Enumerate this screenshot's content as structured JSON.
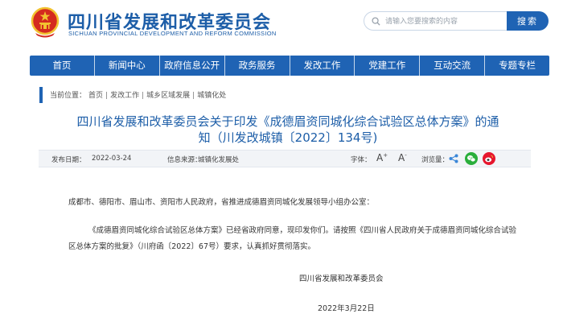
{
  "header": {
    "title": "四川省发展和改革委员会",
    "subtitle": "SICHUAN PROVINCIAL DEVELOPMENT AND REFORM COMMISSION",
    "search_placeholder": "请输入您要搜索的内容",
    "search_button": "搜索"
  },
  "nav": [
    "首页",
    "新闻中心",
    "政府信息公开",
    "政务服务",
    "发改工作",
    "党建工作",
    "互动交流",
    "专题专栏"
  ],
  "breadcrumb": {
    "label": "当前位置：",
    "items": [
      "首页",
      "发改工作",
      "城乡区域发展",
      "城镇化处"
    ]
  },
  "article": {
    "title_line1": "四川省发展和改革委员会关于印发《成德眉资同城化综合试验区总体方案》的通",
    "title_line2": "知（川发改城镇〔2022〕134号)",
    "publish_label": "发布日期：",
    "publish_date": "2022-03-24",
    "source_label": "信息来源：",
    "source": "城镇化发展处",
    "font_label": "字体：",
    "font_up": "A",
    "font_up_mark": "+",
    "font_down": "A",
    "font_down_mark": "-",
    "views_label": "浏览量：",
    "addressee": "成都市、德阳市、眉山市、资阳市人民政府，省推进成德眉资同城化发展领导小组办公室：",
    "body_line1": "《成德眉资同城化综合试验区总体方案》已经省政府同意，现印发你们。请按照《四川省人民政府关于成德眉资同城化综合试验",
    "body_line2": "区总体方案的批复》（川府函〔2022〕67号）要求，认真抓好贯彻落实。",
    "signature": "四川省发展和改革委员会",
    "date": "2022年3月22日"
  },
  "colors": {
    "brand_blue": "#1f63b4",
    "title_blue": "#1d5ea8",
    "emblem_red": "#d42a1f",
    "emblem_gold": "#f2c230",
    "share_blue": "#3a86d8",
    "wechat_green": "#2aae3b",
    "weibo_red": "#e6162d"
  },
  "icons": [
    "national-emblem-icon",
    "search-icon",
    "share-icon",
    "wechat-icon",
    "weibo-icon"
  ]
}
